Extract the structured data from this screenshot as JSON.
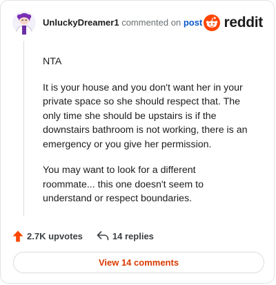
{
  "header": {
    "username": "UnluckyDreamer1",
    "action_text": "commented on",
    "post_link": "post",
    "brand_name": "reddit"
  },
  "comment": {
    "paragraphs": [
      "NTA",
      "It is your house and you don't want her in your private space so she should respect that. The only time she should be upstairs is if the downstairs bathroom is not working, there is an emergency or you give her permission.",
      "You may want to look for a different roommate... this one doesn't seem to understand or respect boundaries."
    ]
  },
  "actions": {
    "upvotes": "2.7K upvotes",
    "replies": "14 replies"
  },
  "view_button": "View 14 comments",
  "colors": {
    "brand": "#ff4500",
    "upvote": "#ff4500",
    "link": "#0a58ca",
    "view_button_text": "#d93a00"
  },
  "icons": [
    "user-avatar",
    "reddit-logo-icon",
    "upvote-arrow-icon",
    "reply-arrow-icon"
  ]
}
